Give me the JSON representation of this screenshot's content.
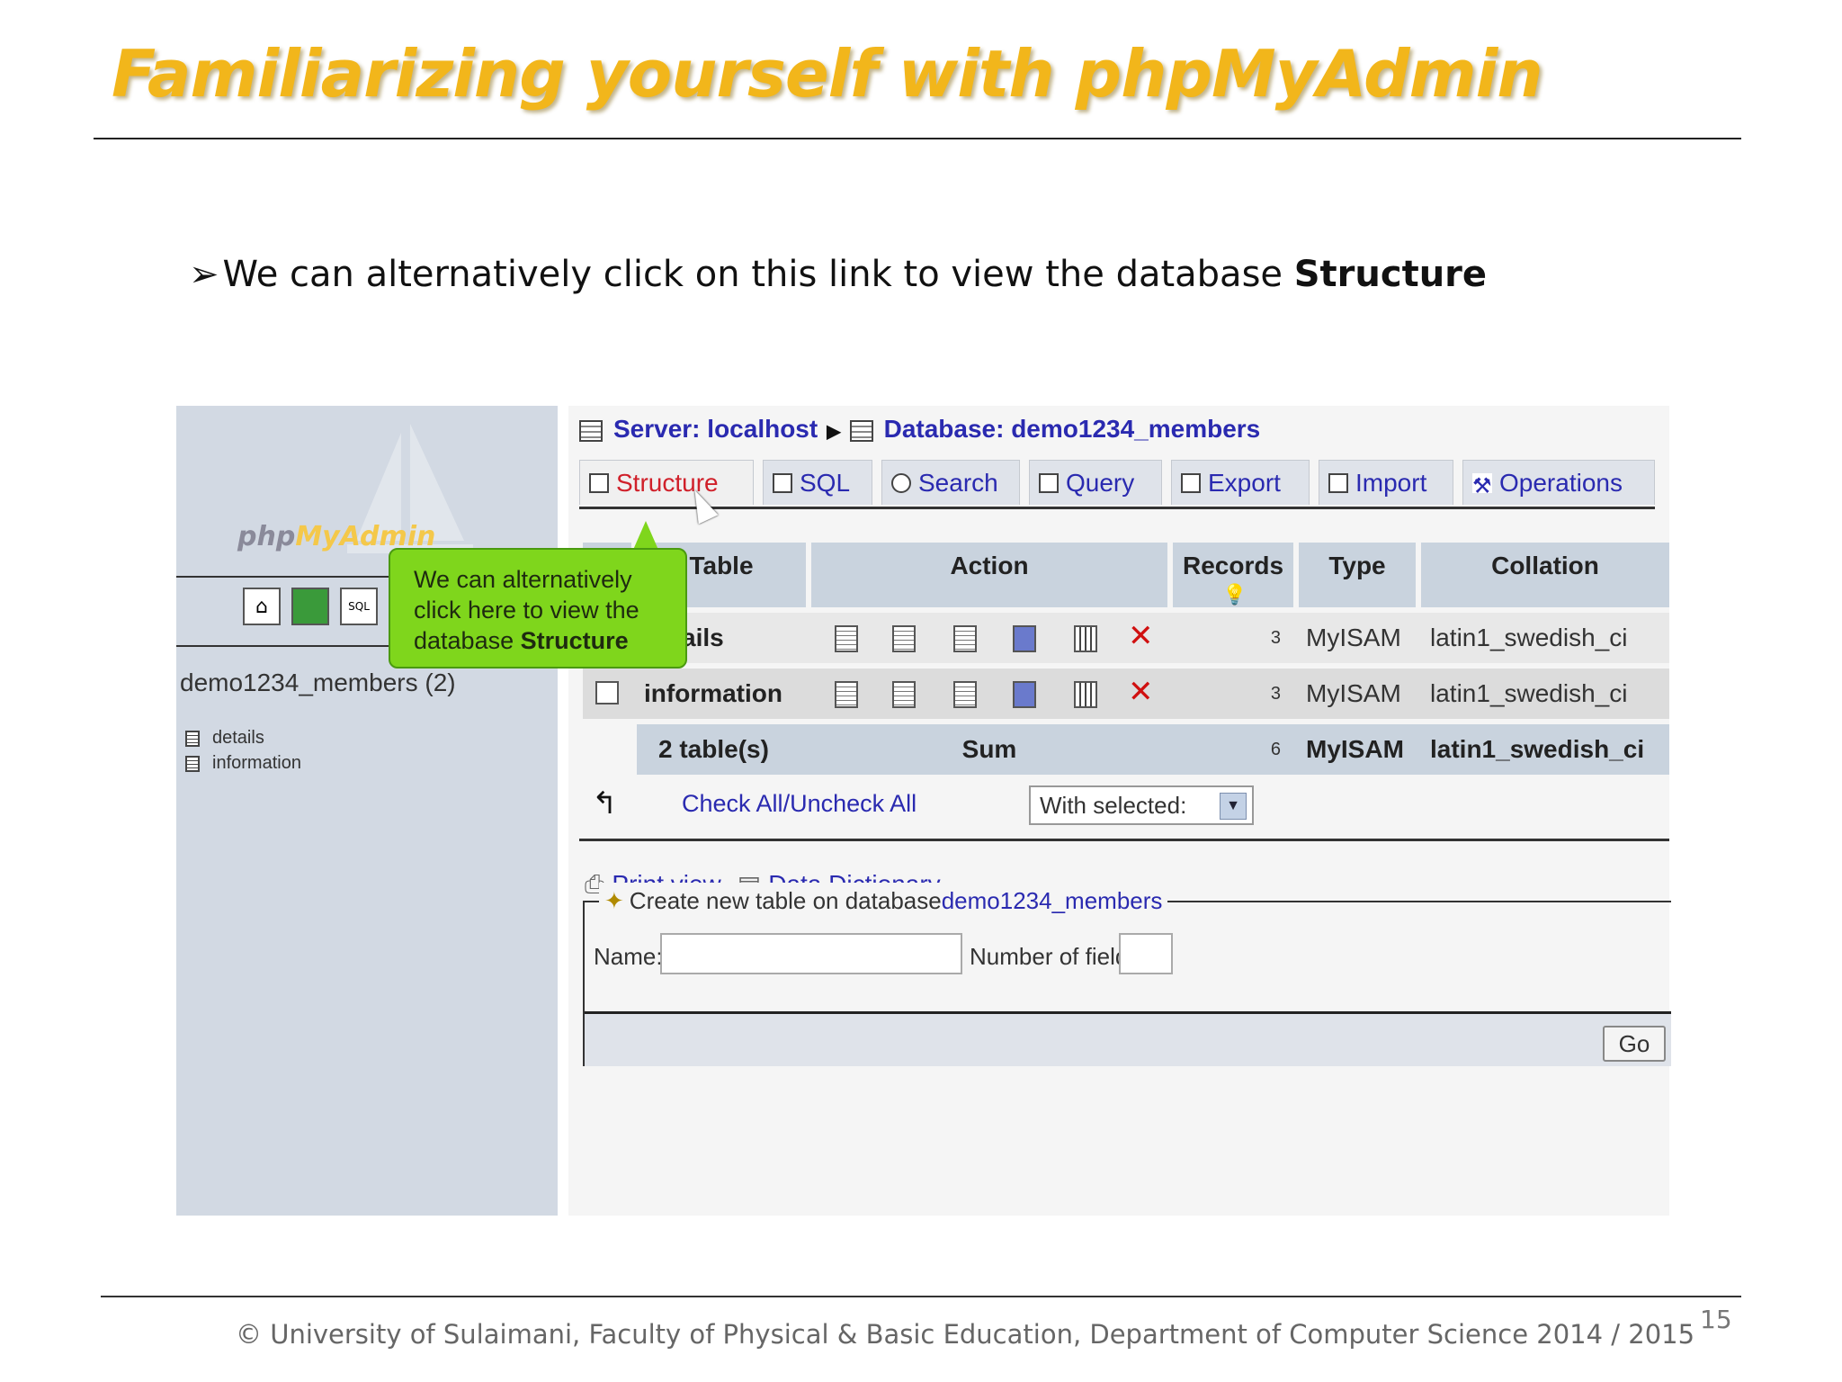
{
  "slide": {
    "title": "Familiarizing yourself with phpMyAdmin",
    "bullet_text": "We can alternatively click on this link to view the database ",
    "bullet_bold": "Structure",
    "footer": "© University of Sulaimani, Faculty of Physical & Basic Education, Department of Computer Science  2014 / 2015",
    "page_number": "15",
    "title_color": "#f2b61b"
  },
  "sidebar": {
    "logo_php": "php",
    "logo_my": "MyAdmin",
    "database": "demo1234_members (2)",
    "tables": [
      "details",
      "information"
    ]
  },
  "breadcrumb": {
    "server": "Server: localhost",
    "database": "Database: demo1234_members"
  },
  "tabs": [
    "Structure",
    "SQL",
    "Search",
    "Query",
    "Export",
    "Import",
    "Operations"
  ],
  "table": {
    "headers": {
      "table": "Table",
      "action": "Action",
      "records": "Records",
      "type": "Type",
      "collation": "Collation"
    },
    "rows": [
      {
        "name": "details",
        "records": "3",
        "type": "MyISAM",
        "collation": "latin1_swedish_ci"
      },
      {
        "name": "information",
        "records": "3",
        "type": "MyISAM",
        "collation": "latin1_swedish_ci"
      }
    ],
    "summary": {
      "count": "2 table(s)",
      "label": "Sum",
      "records": "6",
      "type": "MyISAM",
      "collation": "latin1_swedish_ci"
    }
  },
  "bulk": {
    "check_all": "Check All",
    "separator": " / ",
    "uncheck_all": "Uncheck All",
    "with_selected": "With selected:"
  },
  "links": {
    "print_view": "Print view",
    "data_dictionary": "Data Dictionary"
  },
  "create": {
    "legend": "Create new table on database ",
    "legend_db": "demo1234_members",
    "name_label": "Name:",
    "fields_label": "Number of fields:",
    "name_value": "",
    "fields_value": "",
    "go": "Go"
  },
  "callout": {
    "line1": "We can alternatively",
    "line2": "click here to view the",
    "line3_prefix": "database ",
    "line3_bold": "Structure"
  },
  "colors": {
    "callout": "#7fd61c",
    "link": "#2a2ab0",
    "active_tab": "#d0202a"
  }
}
